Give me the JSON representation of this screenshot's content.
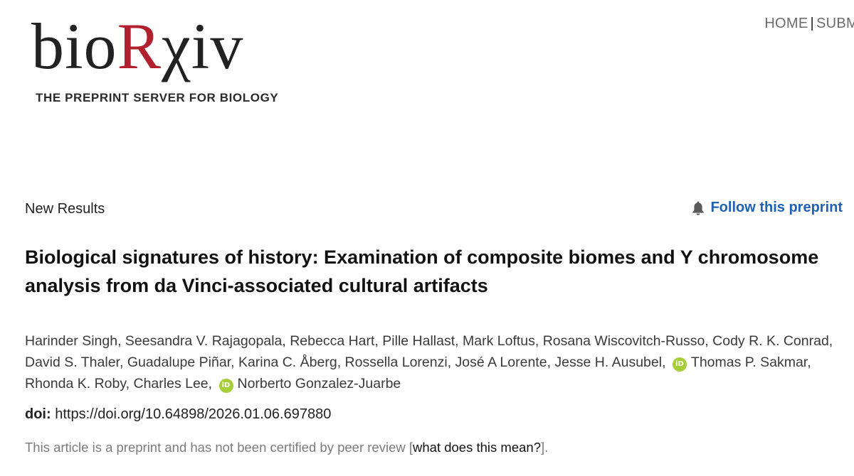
{
  "logo": {
    "word_part1": "bio",
    "word_part2": "R",
    "word_part3": "χ",
    "word_part4": "iv",
    "tagline": "THE PREPRINT SERVER FOR BIOLOGY"
  },
  "nav": {
    "items": [
      {
        "label": "HOME"
      },
      {
        "label": "SUBM"
      }
    ],
    "separator": "|"
  },
  "article": {
    "type": "New Results",
    "follow_label": "Follow this preprint",
    "title": "Biological signatures of history: Examination of composite biomes and Y chromosome analysis from da Vinci-associated cultural artifacts",
    "authors": [
      {
        "name": "Harinder Singh",
        "sep": ", ",
        "orcid": false
      },
      {
        "name": "Seesandra V. Rajagopala",
        "sep": ", ",
        "orcid": false
      },
      {
        "name": "Rebecca Hart",
        "sep": ", ",
        "orcid": false
      },
      {
        "name": "Pille Hallast",
        "sep": ", ",
        "orcid": false
      },
      {
        "name": "Mark Loftus",
        "sep": ", ",
        "orcid": false
      },
      {
        "name": "Rosana Wiscovitch-Russo",
        "sep": ", ",
        "orcid": false
      },
      {
        "name": "Cody R. K. Conrad",
        "sep": ", ",
        "orcid": false
      },
      {
        "name": "David S. Thaler",
        "sep": ", ",
        "orcid": false
      },
      {
        "name": "Guadalupe Piñar",
        "sep": ", ",
        "orcid": false
      },
      {
        "name": "Karina C. Åberg",
        "sep": ", ",
        "orcid": false
      },
      {
        "name": "Rossella Lorenzi",
        "sep": ", ",
        "orcid": false
      },
      {
        "name": "José A Lorente",
        "sep": ", ",
        "orcid": false
      },
      {
        "name": "Jesse H. Ausubel",
        "sep": ", ",
        "orcid": true
      },
      {
        "name": "Thomas P. Sakmar",
        "sep": ", ",
        "orcid": false
      },
      {
        "name": "Rhonda K. Roby",
        "sep": ", ",
        "orcid": false
      },
      {
        "name": "Charles Lee",
        "sep": ", ",
        "orcid": true
      },
      {
        "name": "Norberto Gonzalez-Juarbe",
        "sep": "",
        "orcid": false
      }
    ],
    "orcid_badge": "iD",
    "doi_label": "doi:",
    "doi_url": "https://doi.org/10.64898/2026.01.06.697880",
    "disclaimer_text": "This article is a preprint and has not been certified by peer review [",
    "disclaimer_link": "what does this mean?",
    "disclaimer_end": "]."
  },
  "colors": {
    "logo_red": "#b21f2d",
    "link_blue": "#1f61b5",
    "orcid_green": "#a6ce39"
  },
  "icons": {
    "follow": "bell-icon",
    "orcid": "orcid-icon"
  }
}
